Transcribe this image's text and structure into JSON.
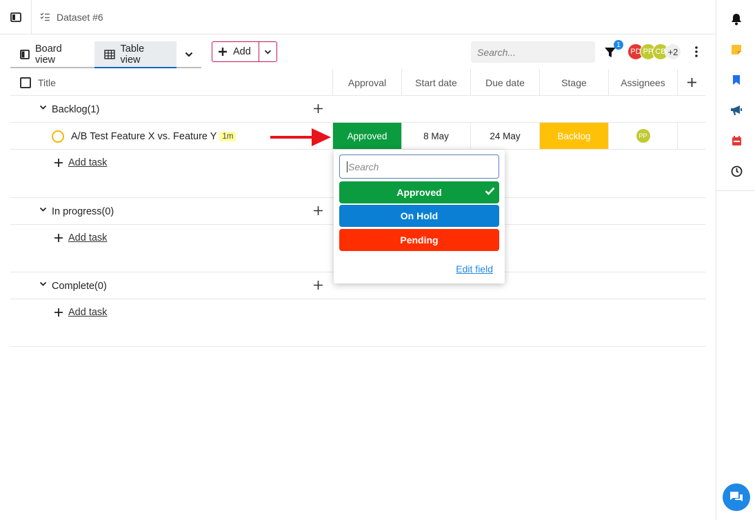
{
  "breadcrumb": {
    "dataset_name": "Dataset #6"
  },
  "toolbar": {
    "tabs": [
      {
        "label": "Board view",
        "icon": "board-icon"
      },
      {
        "label": "Table view",
        "icon": "table-icon",
        "active": true
      }
    ],
    "add_label": "Add",
    "search_placeholder": "Search...",
    "filter_count": "1",
    "avatars": [
      {
        "initials": "PD",
        "color": "#e53935"
      },
      {
        "initials": "PP",
        "color": "#c0ca33"
      },
      {
        "initials": "CB",
        "color": "#c0ca33"
      }
    ],
    "avatars_more": "+2"
  },
  "table": {
    "title_header": "Title",
    "columns": [
      "Approval",
      "Start date",
      "Due date",
      "Stage",
      "Assignees"
    ],
    "groups": [
      {
        "name": "Backlog(1)",
        "tasks": [
          {
            "title": "A/B Test Feature X vs. Feature Y",
            "time": "1m",
            "approval": "Approved",
            "start_date": "8 May",
            "due_date": "24 May",
            "stage": "Backlog",
            "assignee": "PP"
          }
        ],
        "add_task_label": "Add task"
      },
      {
        "name": "In progress(0)",
        "tasks": [],
        "add_task_label": "Add task"
      },
      {
        "name": "Complete(0)",
        "tasks": [],
        "add_task_label": "Add task"
      }
    ]
  },
  "approval_dropdown": {
    "search_placeholder": "Search",
    "options": [
      {
        "label": "Approved",
        "color": "#0b9c3f",
        "selected": true
      },
      {
        "label": "On Hold",
        "color": "#0a7fd4"
      },
      {
        "label": "Pending",
        "color": "#ff2e00"
      }
    ],
    "edit_field_label": "Edit field"
  },
  "colors": {
    "approved": "#0b9c3f",
    "stage_backlog": "#ffc107",
    "assignee_pp": "#c0ca33",
    "annotation_arrow": "#e8141c"
  }
}
